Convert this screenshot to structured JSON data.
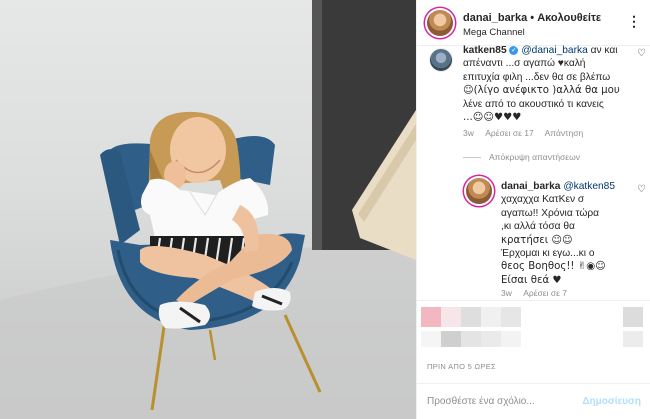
{
  "header": {
    "username": "danai_barka",
    "separator": "•",
    "follow_label": "Ακολουθείτε",
    "subtitle": "Mega Channel",
    "more_glyph": "⋮"
  },
  "comment1": {
    "username": "katken85",
    "verified_glyph": "✓",
    "mention": "@danai_barka",
    "text_lines": [
      "αν και",
      "απέναντι ...σ αγαπώ ♥καλή",
      "επιτυχία φιλη ...δεν θα σε βλέπω",
      "☺(λίγο ανέφικτο )αλλά θα μου",
      "λένε από το ακουστικό τι κανεις",
      "...☺☺♥♥♥"
    ],
    "time": "3w",
    "likes": "Αρέσει σε 17",
    "reply_label": "Απάντηση",
    "heart_glyph": "♡"
  },
  "hidden_replies_label": "Απόκρυψη απαντήσεων",
  "reply": {
    "username": "danai_barka",
    "mention": "@katken85",
    "text_lines": [
      "χαχαχχα ΚατΚεν σ",
      "αγαπω!! Χρόνια τώρα",
      ",κι αλλά τόσα θα",
      "κρατήσει ☺☺",
      "Έρχομαι κι εγω...κι ο",
      "θεος Βοηθος!! ✌◉☺",
      "Είσαι θεά ♥"
    ],
    "time": "3w",
    "likes": "Αρέσει σε 7",
    "heart_glyph": "♡"
  },
  "post_date": "ΠΡΙΝ ΑΠΟ 5 ΩΡΕΣ",
  "add_comment": {
    "placeholder": "Προσθέστε ένα σχόλιο...",
    "post_label": "Δημοσίευση"
  },
  "colors": {
    "chair_blue": "#2f5f88",
    "link_blue": "#00376b",
    "post_disabled": "#b2dffc",
    "meta_gray": "#8e8e8e"
  }
}
